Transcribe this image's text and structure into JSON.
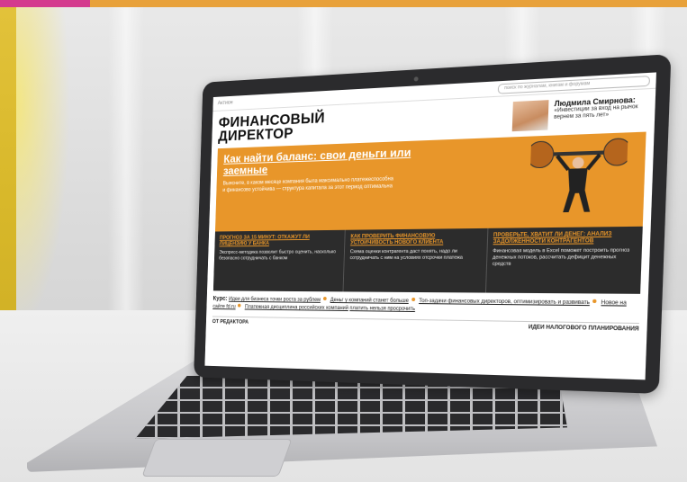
{
  "site": {
    "logo": "Актион",
    "search_placeholder": "поиск по журналам, книгам и форумам",
    "brand_line1": "ФИНАНСОВЫЙ",
    "brand_line2": "ДИРЕКТОР",
    "author": {
      "name": "Людмила Смирнова:",
      "quote": "«Инвестиции за вход на рынок вернем за пять лет»"
    },
    "hero": {
      "title": "Как найти баланс: свои деньги или заемные",
      "text": "Выясните, в каком месяце компания была максимально платежеспособна и финансово устойчива — структура капитала за этот период оптимальна"
    },
    "cards": [
      {
        "title": "ПРОГНОЗ ЗА 15 МИНУТ: ОТКАЖУТ ЛИ ЛИЦЕНЗИЮ У БАНКА",
        "text": "Экспресс-методика позволит быстро оценить, насколько безопасно сотрудничать с банком"
      },
      {
        "title": "КАК ПРОВЕРИТЬ ФИНАНСОВУЮ УСТОЙЧИВОСТЬ НОВОГО КЛИЕНТА",
        "text": "Схема оценки контрагента даст понять, надо ли сотрудничать с ним на условиях отсрочки платежа"
      },
      {
        "title": "ПРОВЕРЬТЕ, ХВАТИТ ЛИ ДЕНЕГ: АНАЛИЗ ЗАДОЛЖЕННОСТИ КОНТРАГЕНТОВ",
        "text": "Финансовая модель в Excel поможет построить прогноз денежных потоков, рассчитать дефицит денежных средств"
      }
    ],
    "course": {
      "label": "Курс:",
      "links": [
        "Идеи для бизнеса точки роста за рублем",
        "Деньг у компаний станет больше",
        "Топ-задачи финансовых директоров, оптимизировать и развивать",
        "Новое на сайте fd.ru",
        "Платежная дисциплина российских компаний",
        "платить нельзя просрочить"
      ]
    },
    "footer": {
      "left": "ОТ РЕДАКТОРА",
      "right": "ИДЕИ НАЛОГОВОГО ПЛАНИРОВАНИЯ"
    }
  },
  "colors": {
    "accent": "#e8962a",
    "dark": "#2c2c2c",
    "top_strip_pink": "#d43a8e"
  }
}
